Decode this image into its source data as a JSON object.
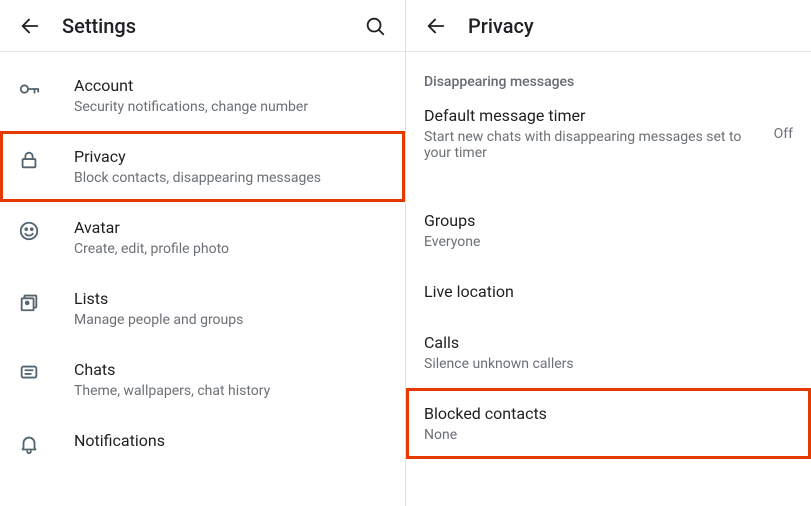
{
  "left": {
    "title": "Settings",
    "items": [
      {
        "icon": "key",
        "label": "Account",
        "sub": "Security notifications, change number"
      },
      {
        "icon": "lock",
        "label": "Privacy",
        "sub": "Block contacts, disappearing messages",
        "highlight": true
      },
      {
        "icon": "avatar",
        "label": "Avatar",
        "sub": "Create, edit, profile photo"
      },
      {
        "icon": "lists",
        "label": "Lists",
        "sub": "Manage people and groups"
      },
      {
        "icon": "chats",
        "label": "Chats",
        "sub": "Theme, wallpapers, chat history"
      },
      {
        "icon": "bell",
        "label": "Notifications",
        "sub": ""
      }
    ]
  },
  "right": {
    "title": "Privacy",
    "section_header": "Disappearing messages",
    "items": [
      {
        "label": "Default message timer",
        "sub": "Start new chats with disappearing messages set to your timer",
        "trailing": "Off"
      },
      {
        "label": "Groups",
        "sub": "Everyone"
      },
      {
        "label": "Live location",
        "sub": ""
      },
      {
        "label": "Calls",
        "sub": "Silence unknown callers"
      },
      {
        "label": "Blocked contacts",
        "sub": "None",
        "highlight": true
      }
    ]
  }
}
